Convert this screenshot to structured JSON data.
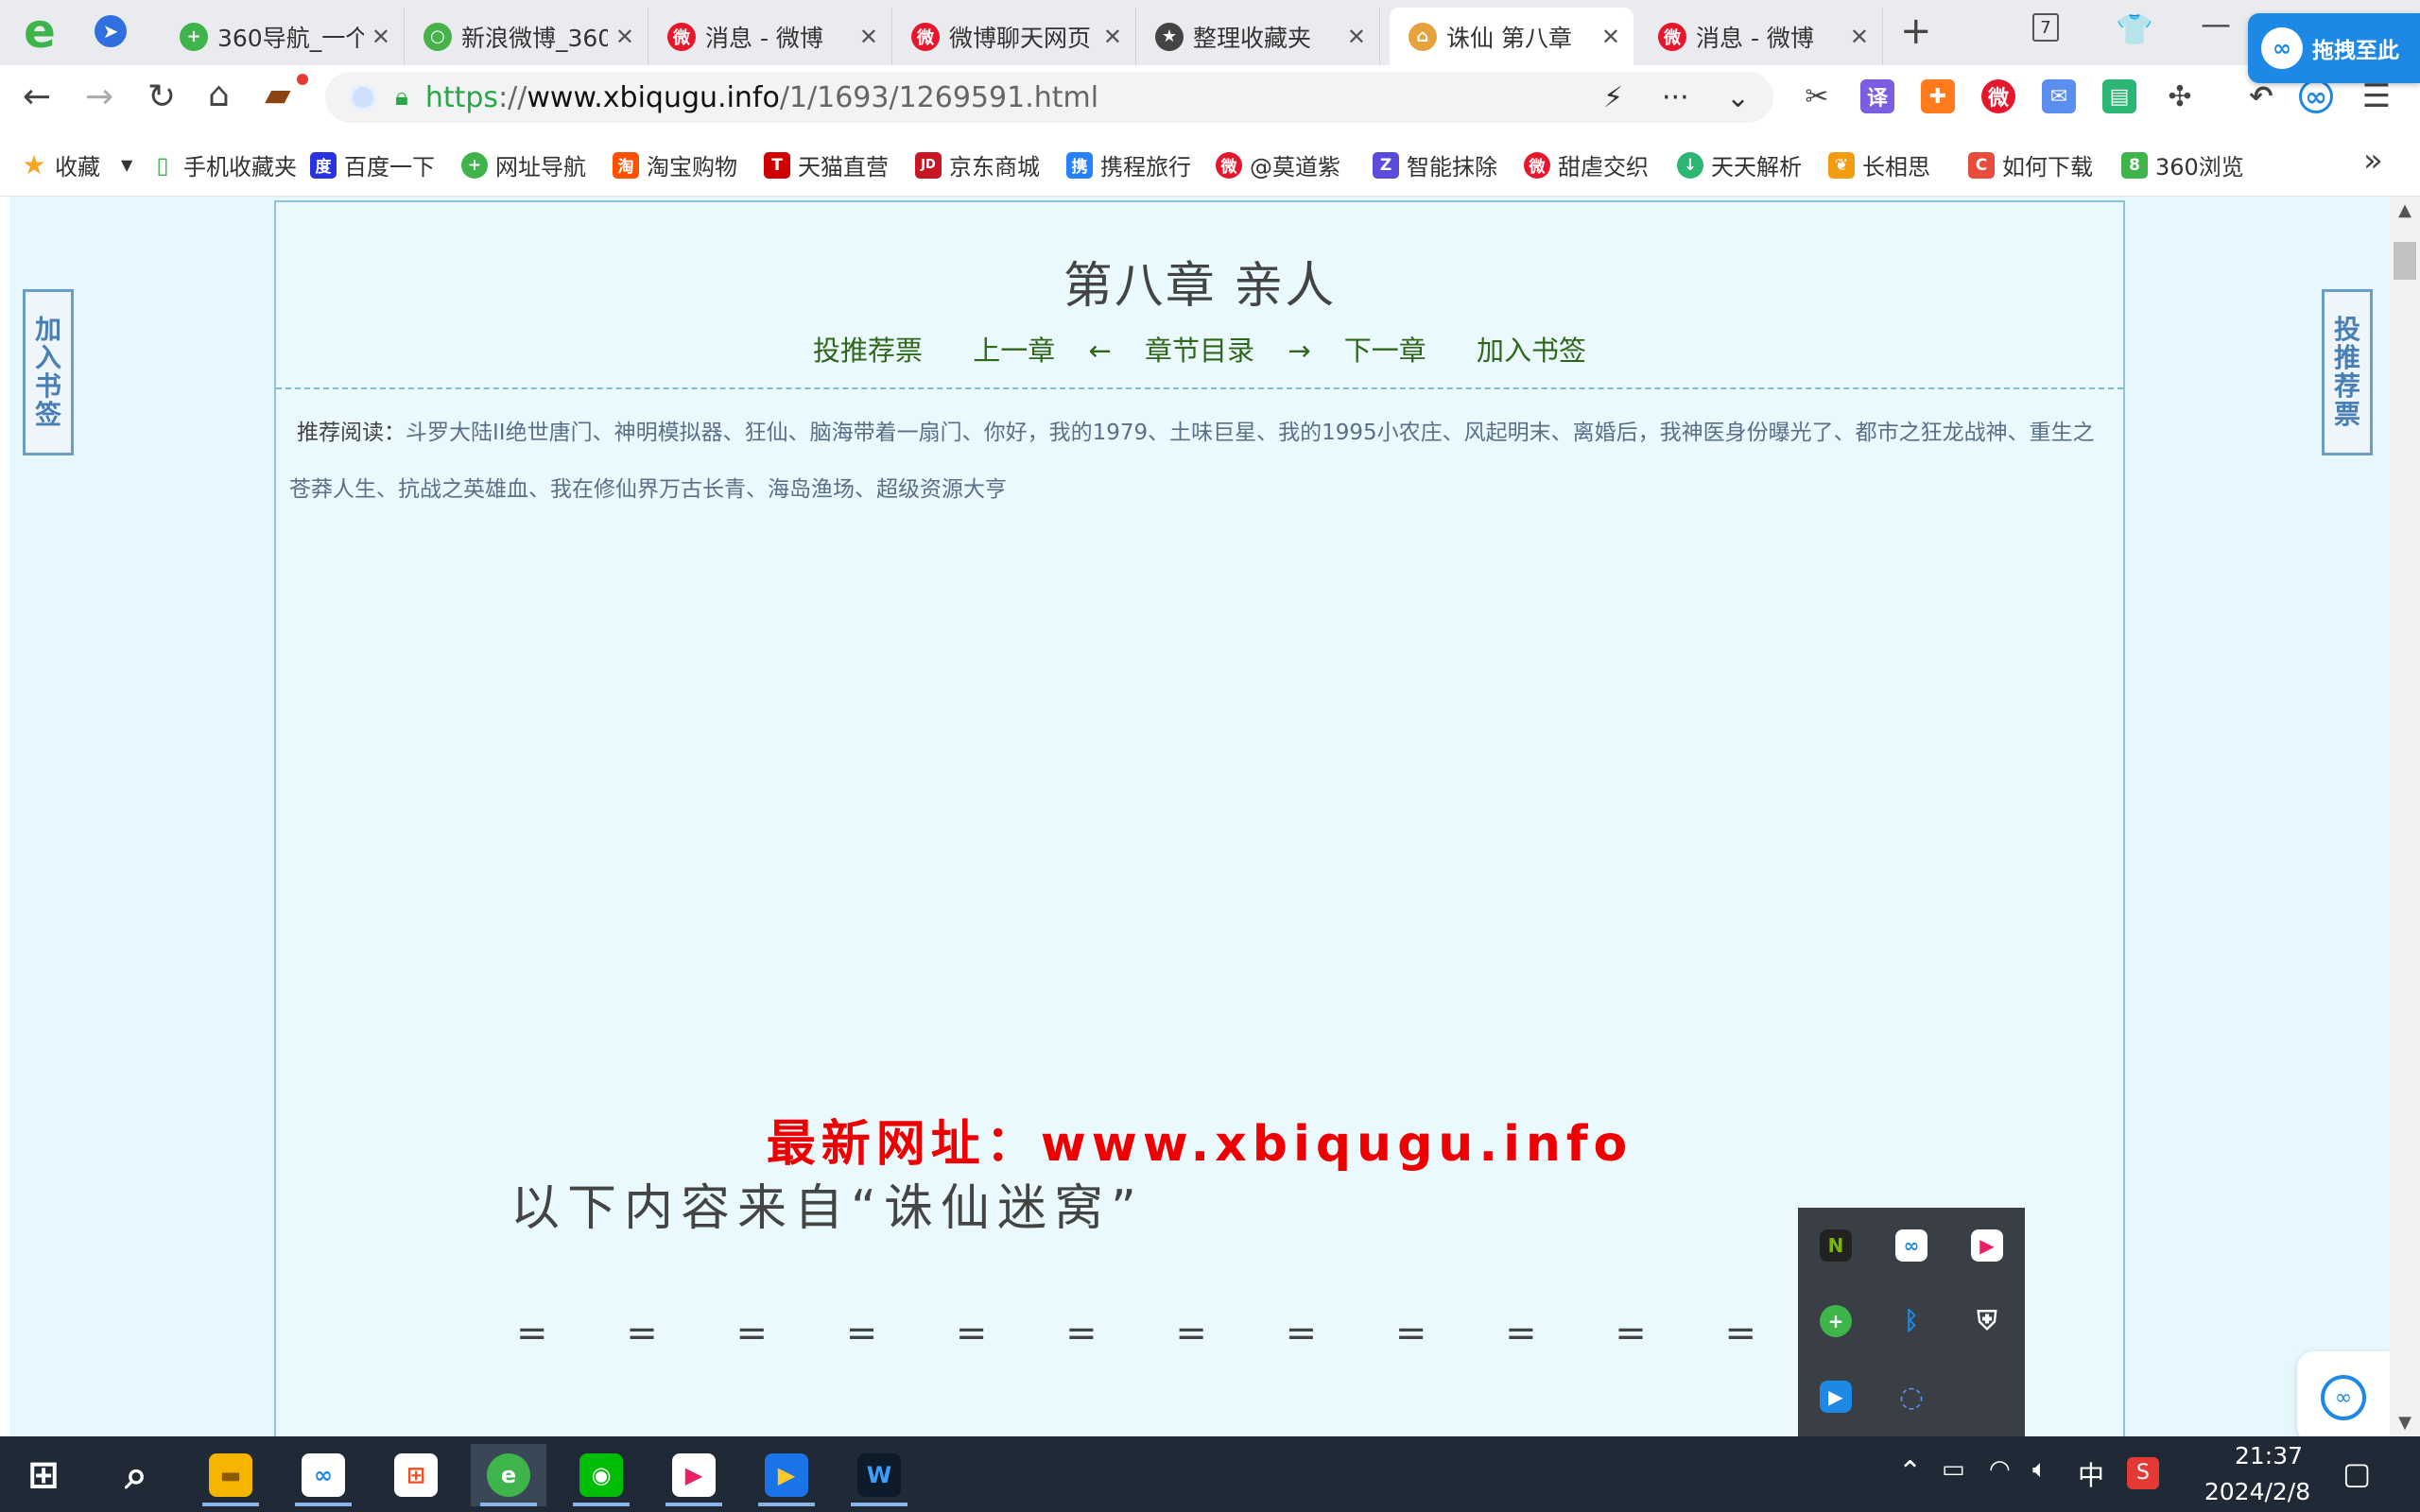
{
  "tabs": [
    {
      "title": "360导航_一个",
      "fav": "+",
      "fav_color": "#3fb44a"
    },
    {
      "title": "新浪微博_360",
      "fav": "○",
      "fav_color": "#47b24a"
    },
    {
      "title": "消息 - 微博",
      "fav": "微",
      "fav_color": "#e6162d"
    },
    {
      "title": "微博聊天网页",
      "fav": "微",
      "fav_color": "#e6162d"
    },
    {
      "title": "整理收藏夹",
      "fav": "★",
      "fav_color": "#444444"
    },
    {
      "title": "诛仙 第八章",
      "fav": "⌂",
      "fav_color": "#e6a23c"
    },
    {
      "title": "消息 - 微博",
      "fav": "微",
      "fav_color": "#e6162d"
    }
  ],
  "window": {
    "logo": "e",
    "new_tab": "+",
    "tab_count": "7",
    "skin": "⌕",
    "minimize": "—",
    "drag_search": "拖拽至此"
  },
  "address": {
    "scheme": "https",
    "sep": "://",
    "domain": "www.xbiqugu.info",
    "path": "/1/1693/1269591.html"
  },
  "bookmarks": [
    {
      "label": "收藏",
      "icon": "★",
      "color": "#f5a623"
    },
    {
      "label": "手机收藏夹",
      "icon": "▯",
      "color": "#3fb44a"
    },
    {
      "label": "百度一下",
      "icon": "度",
      "color": "#2932e1"
    },
    {
      "label": "网址导航",
      "icon": "+",
      "color": "#3fb44a"
    },
    {
      "label": "淘宝购物",
      "icon": "淘",
      "color": "#ff5000"
    },
    {
      "label": "天猫直营",
      "icon": "T",
      "color": "#d00000"
    },
    {
      "label": "京东商城",
      "icon": "JD",
      "color": "#c91623"
    },
    {
      "label": "携程旅行",
      "icon": "携",
      "color": "#2681ff"
    },
    {
      "label": "@莫道紫",
      "icon": "微",
      "color": "#e6162d"
    },
    {
      "label": "智能抹除",
      "icon": "Z",
      "color": "#5b4bdb"
    },
    {
      "label": "甜虐交织",
      "icon": "微",
      "color": "#e6162d"
    },
    {
      "label": "天天解析",
      "icon": "↓",
      "color": "#2bb673"
    },
    {
      "label": "长相思",
      "icon": "❦",
      "color": "#f39c12"
    },
    {
      "label": "如何下载",
      "icon": "C",
      "color": "#e74c3c"
    },
    {
      "label": "360浏览",
      "icon": "8",
      "color": "#3fb44a"
    }
  ],
  "bookmarks_more": "»",
  "page": {
    "chapter_title": "第八章 亲人",
    "nav": [
      "投推荐票",
      "上一章",
      "←",
      "章节目录",
      "→",
      "下一章",
      "加入书签"
    ],
    "recommend_label": "推荐阅读：",
    "recommend_links": "斗罗大陆II绝世唐门、神明模拟器、狂仙、脑海带着一扇门、你好，我的1979、土味巨星、我的1995小农庄、风起明末、离婚后，我神医身份曝光了、都市之狂龙战神、重生之苍莽人生、抗战之英雄血、我在修仙界万古长青、海岛渔场、超级资源大亨",
    "new_url": "最新网址：www.xbiqugu.info",
    "from_line": "以下内容来自“诛仙迷窝”",
    "equals": "= = = = = = = = = = = = = =",
    "left_side_tab": [
      "加",
      "入",
      "书",
      "签"
    ],
    "right_side_tab": [
      "投",
      "推",
      "荐",
      "票"
    ]
  },
  "tray_popup": [
    {
      "name": "nvidia-icon",
      "glyph": "N",
      "color": "#76b900"
    },
    {
      "name": "baidu-netdisk-icon",
      "glyph": "∞",
      "color": "#ffffff"
    },
    {
      "name": "youku-icon",
      "glyph": "▶",
      "color": "#ffffff"
    },
    {
      "name": "360-icon",
      "glyph": "+",
      "color": "#3fb44a"
    },
    {
      "name": "bluetooth-icon",
      "glyph": "ᛒ",
      "color": "#1e88e5"
    },
    {
      "name": "security-shield-icon",
      "glyph": "⛨",
      "color": "#ffffff"
    },
    {
      "name": "feishu-icon",
      "glyph": "▶",
      "color": "#1e88e5"
    },
    {
      "name": "loading-circle-icon",
      "glyph": "◌",
      "color": "#3a3f45"
    }
  ],
  "taskbar": {
    "start": "⊞",
    "search": "⌕",
    "ime": "中",
    "time": "21:37",
    "date": "2024/2/8"
  }
}
